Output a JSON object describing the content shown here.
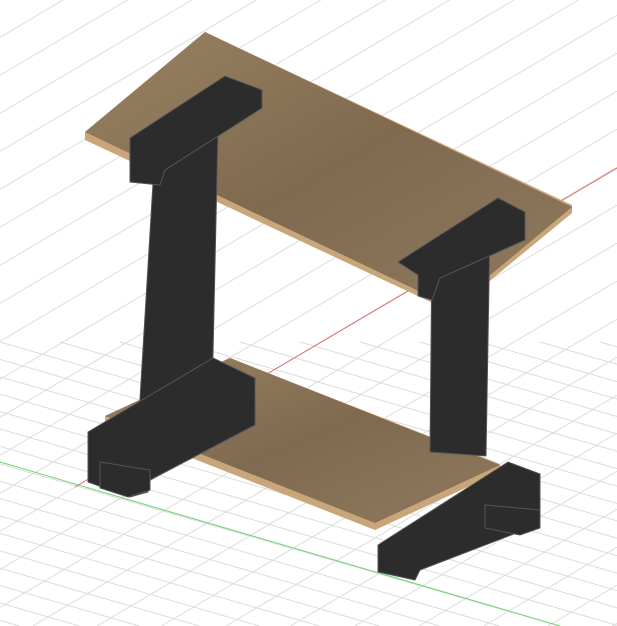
{
  "viewport": {
    "model": "table",
    "colors": {
      "background": "#ffffff",
      "grid": "#dcdcdc",
      "x_axis": "#e06a6a",
      "y_axis": "#6fd46f",
      "wood": "#8a7358",
      "wood_light": "#a58b6b",
      "wood_edge": "#c9a57a",
      "metal": "#2c2c2c",
      "metal_edge": "#555555"
    }
  }
}
